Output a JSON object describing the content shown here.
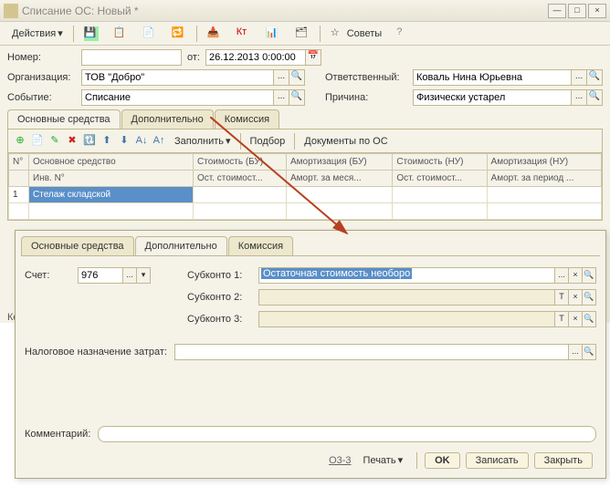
{
  "window": {
    "title": "Списание ОС: Новый *"
  },
  "toolbar": {
    "actions_label": "Действия",
    "tips_label": "Советы"
  },
  "header": {
    "number_label": "Номер:",
    "date_label": "от:",
    "date_value": "26.12.2013 0:00:00",
    "org_label": "Организация:",
    "org_value": "ТОВ \"Добро\"",
    "event_label": "Событие:",
    "event_value": "Списание",
    "resp_label": "Ответственный:",
    "resp_value": "Коваль Нина Юрьевна",
    "reason_label": "Причина:",
    "reason_value": "Физически устарел"
  },
  "main_tabs": [
    "Основные средства",
    "Дополнительно",
    "Комиссия"
  ],
  "sub_actions": {
    "fill": "Заполнить",
    "select": "Подбор",
    "docs": "Документы по ОС"
  },
  "table": {
    "headers1": [
      "N°",
      "Основное средство",
      "Стоимость (БУ)",
      "Амортизация (БУ)",
      "Стоимость (НУ)",
      "Амортизация (НУ)"
    ],
    "headers2": [
      "",
      "Инв. N°",
      "Ост. стоимост...",
      "Аморт. за меся...",
      "Ост. стоимост...",
      "Аморт. за период ..."
    ],
    "row1": {
      "n": "1",
      "name": "Стелаж складской"
    }
  },
  "panel": {
    "tabs": [
      "Основные средства",
      "Дополнительно",
      "Комиссия"
    ],
    "account_label": "Счет:",
    "account_value": "976",
    "sub1_label": "Субконто 1:",
    "sub1_value": "Остаточная стоимость необоро",
    "sub2_label": "Субконто 2:",
    "sub3_label": "Субконто 3:",
    "tax_label": "Налоговое назначение затрат:",
    "comment_label": "Комментарий:"
  },
  "footer": {
    "form_code": "О3-3",
    "print": "Печать",
    "ok": "OK",
    "save": "Записать",
    "close": "Закрыть"
  },
  "main_comment_label": "Коммен"
}
